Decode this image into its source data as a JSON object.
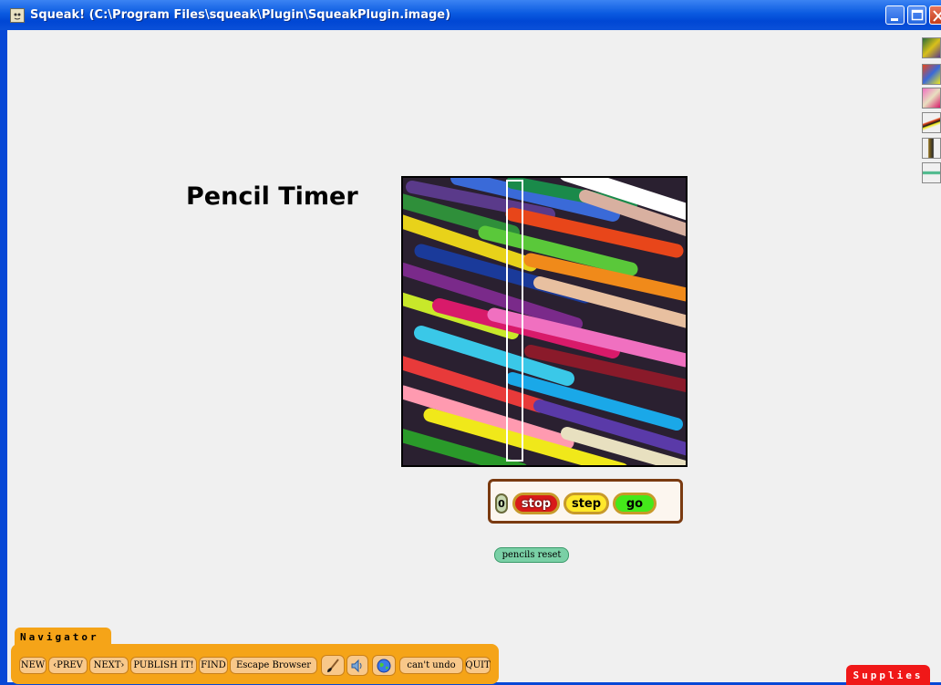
{
  "window": {
    "title": "Squeak! (C:\\Program Files\\squeak\\Plugin\\SqueakPlugin.image)",
    "app_icon": "squeak-icon",
    "controls": [
      "minimize",
      "maximize",
      "close"
    ]
  },
  "page": {
    "title": "Pencil Timer"
  },
  "controls": {
    "counter": "0",
    "stop_label": "stop",
    "step_label": "step",
    "go_label": "go",
    "reset_label": "pencils reset"
  },
  "thumbnails": [
    "thumbnail-1",
    "thumbnail-2",
    "thumbnail-3",
    "thumbnail-4",
    "thumbnail-5",
    "thumbnail-6"
  ],
  "navigator": {
    "tab_label": "Navigator",
    "buttons": {
      "new": "NEW",
      "prev": "PREV",
      "next": "NEXT",
      "publish": "PUBLISH IT!",
      "find": "FIND",
      "escape": "Escape Browser",
      "undo": "can't undo",
      "quit": "QUIT"
    },
    "icons": [
      "paintbrush-icon",
      "speaker-icon",
      "globe-icon"
    ]
  },
  "supplies": {
    "tab_label": "Supplies"
  },
  "colors": {
    "titlebar": "#0a5ae0",
    "navigator": "#f5a418",
    "supplies": "#f01818",
    "stop": "#d81a1a",
    "step": "#ffe82a",
    "go": "#44e81a",
    "reset": "#7ad0a6",
    "panel_border": "#7a3a10"
  }
}
